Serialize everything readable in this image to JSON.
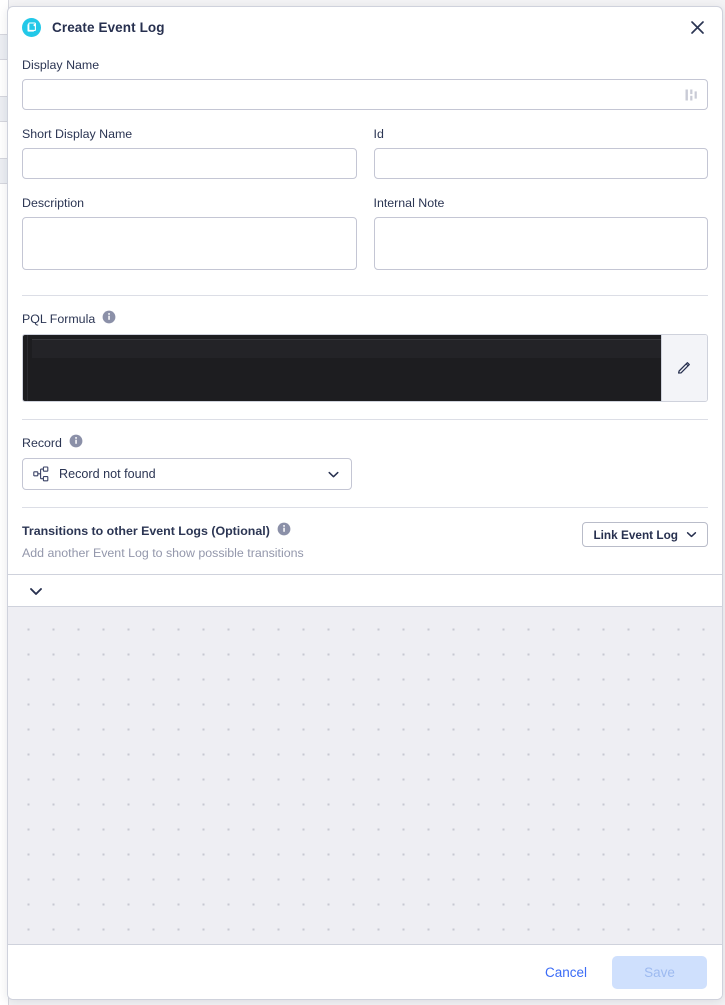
{
  "header": {
    "title": "Create Event Log",
    "app_icon": "event-log-icon",
    "close_icon": "close-icon"
  },
  "form": {
    "display_name": {
      "label": "Display Name",
      "value": "",
      "placeholder": "",
      "suffix_icon": "translations-icon"
    },
    "short_display_name": {
      "label": "Short Display Name",
      "value": "",
      "placeholder": ""
    },
    "id": {
      "label": "Id",
      "value": "",
      "placeholder": ""
    },
    "description": {
      "label": "Description",
      "value": "",
      "placeholder": ""
    },
    "internal_note": {
      "label": "Internal Note",
      "value": "",
      "placeholder": ""
    },
    "pql_formula": {
      "label": "PQL Formula",
      "info_icon": "info-icon",
      "value": "",
      "edit_icon": "pencil-icon"
    },
    "record": {
      "label": "Record",
      "info_icon": "info-icon",
      "selected": "Record not found",
      "options": [
        "Record not found"
      ],
      "item_icon": "hierarchy-icon",
      "chevron_icon": "chevron-down-icon"
    }
  },
  "transitions": {
    "title": "Transitions to other Event Logs (Optional)",
    "info_icon": "info-icon",
    "subtitle": "Add another Event Log to show possible transitions",
    "link_button": {
      "label": "Link Event Log",
      "chevron_icon": "chevron-down-icon"
    }
  },
  "canvas": {
    "toggle_icon": "chevron-down-icon"
  },
  "footer": {
    "cancel_label": "Cancel",
    "save_label": "Save"
  },
  "colors": {
    "accent_blue": "#3b6cf6",
    "brand_cyan": "#22c8e8",
    "text_dark": "#27304f",
    "muted": "#9397ab",
    "editor_bg": "#1d1d20",
    "save_disabled_bg": "#cfe0fd"
  }
}
